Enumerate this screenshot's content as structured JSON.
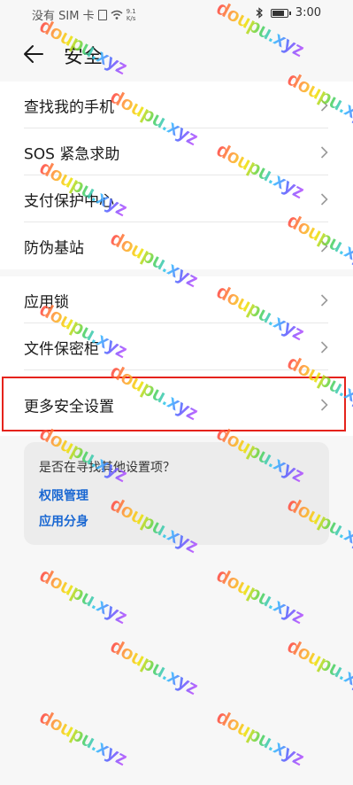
{
  "status_bar": {
    "carrier": "没有 SIM 卡",
    "speed_top": "9.1",
    "speed_bottom": "K/s",
    "time": "3:00",
    "battery_level": 0.85,
    "icons": [
      "sim-card-icon",
      "wifi-icon",
      "bluetooth-icon",
      "battery-icon"
    ]
  },
  "header": {
    "title": "安全",
    "back_icon": "back-arrow-icon"
  },
  "group1": [
    {
      "label": "查找我的手机"
    },
    {
      "label": "SOS 紧急求助"
    },
    {
      "label": "支付保护中心"
    },
    {
      "label": "防伪基站"
    }
  ],
  "group2": [
    {
      "label": "应用锁"
    },
    {
      "label": "文件保密柜"
    },
    {
      "label": "更多安全设置"
    }
  ],
  "suggestion": {
    "question": "是否在寻找其他设置项？",
    "links": [
      "权限管理",
      "应用分身"
    ]
  },
  "watermark": {
    "text": "doupu.xyz"
  },
  "colors": {
    "highlight": "#e5231c",
    "link": "#1967d2",
    "background": "#f7f7f7"
  }
}
